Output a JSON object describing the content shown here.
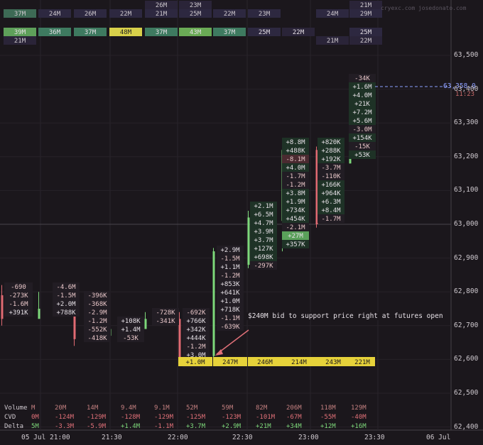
{
  "watermark": "cryexc.com josedonato.com",
  "price_axis": {
    "ticks": [
      "63,500",
      "63,400",
      "63,300",
      "63,200",
      "63,100",
      "63,000",
      "62,900",
      "62,800",
      "62,700",
      "62,600",
      "62,500",
      "62,400"
    ]
  },
  "time_axis": {
    "ticks": [
      "05 Jul 21:00",
      "21:30",
      "22:00",
      "22:30",
      "23:00",
      "23:30",
      "06 Jul"
    ]
  },
  "current_price": {
    "value": "63,358.0",
    "time_left": "11:23",
    "color": "#8ea0ff"
  },
  "annotation": "$240M bid to support price right at futures open",
  "colors": {
    "bg": "#1b171c",
    "green": "#7dd87a",
    "red": "#e06a72",
    "yellow_highlight": "#e6d23a"
  },
  "top_heatmap_row1": [
    "37M",
    "24M",
    "26M",
    "22M",
    "21M",
    "25M",
    "22M",
    "23M",
    "",
    "24M",
    "29M"
  ],
  "top_heatmap_row1_above": [
    "",
    "",
    "",
    "",
    "26M",
    "23M",
    "",
    "",
    "",
    "",
    "21M"
  ],
  "top_heatmap_row2": [
    "39M",
    "36M",
    "37M",
    "48M",
    "37M",
    "43M",
    "37M",
    "25M",
    "22M",
    "",
    "25M"
  ],
  "top_heatmap_row2_below": [
    "21M",
    "",
    "",
    "",
    "",
    "",
    "",
    "",
    "",
    "21M",
    "22M"
  ],
  "bottom_bid_row": [
    "+1.0M",
    "247M",
    "246M",
    "214M",
    "243M",
    "221M"
  ],
  "footprint_columns": [
    {
      "cells": [
        "-690",
        "-273K",
        "-1.6M",
        "+391K"
      ]
    },
    {
      "cells": [
        "-4.6M",
        "-1.5M",
        "+2.0M",
        "+788K"
      ]
    },
    {
      "cells": [
        "-396K",
        "-368K",
        "-2.9M",
        "-1.2M",
        "-552K",
        "-418K"
      ]
    },
    {
      "cells": [
        "+108K",
        "+1.4M",
        "-53K"
      ]
    },
    {
      "cells": [
        "-728K",
        "-341K"
      ]
    },
    {
      "cells": [
        "-692K",
        "+766K",
        "+342K",
        "+444K",
        "-1.2M",
        "+3.0M",
        "+1.0M"
      ]
    },
    {
      "cells": [
        "+2.9M",
        "-1.5M",
        "+1.1M",
        "-1.2M",
        "+853K",
        "+641K",
        "+1.0M",
        "+718K",
        "-1.1M",
        "-639K"
      ]
    },
    {
      "cells": [
        "+2.1M",
        "+6.5M",
        "+4.7M",
        "+3.9M",
        "+3.7M",
        "+127K",
        "+698K",
        "-297K"
      ]
    },
    {
      "cells": [
        "+8.8M",
        "+488K",
        "-8.1M",
        "+4.0M",
        "-1.7M",
        "-1.2M",
        "+3.8M",
        "+1.9M",
        "+734K",
        "+454K",
        "-2.1M",
        "+27M",
        "+357K"
      ]
    },
    {
      "cells": [
        "+820K",
        "+288K",
        "+192K",
        "-3.7M",
        "-110K",
        "+166K",
        "+964K",
        "+6.3M",
        "+8.4M",
        "-1.7M"
      ]
    },
    {
      "cells": [
        "-34K",
        "+1.6M",
        "+4.0M",
        "+21K",
        "+7.2M",
        "+5.6M",
        "-3.0M",
        "+154K",
        "-15K",
        "+53K"
      ]
    }
  ],
  "summary": {
    "volume_label": "Volume",
    "cvd_label": "CVD",
    "delta_label": "Delta",
    "volume": [
      "M",
      "20M",
      "14M",
      "9.4M",
      "9.1M",
      "52M",
      "59M",
      "82M",
      "206M",
      "118M",
      "129M"
    ],
    "cvd": [
      "0M",
      "-124M",
      "-129M",
      "-128M",
      "-129M",
      "-125M",
      "-123M",
      "-101M",
      "-67M",
      "-55M",
      "-40M"
    ],
    "delta": [
      "5M",
      "-3.3M",
      "-5.9M",
      "+1.4M",
      "-1.1M",
      "+3.7M",
      "+2.9M",
      "+21M",
      "+34M",
      "+12M",
      "+16M"
    ]
  },
  "chart_data": {
    "type": "footprint",
    "x": [
      "21:00",
      "21:15",
      "21:30",
      "21:45",
      "22:00",
      "22:15",
      "22:30",
      "22:45",
      "23:00",
      "23:15",
      "23:30"
    ],
    "series": [
      {
        "open": 62790,
        "close": 62720,
        "high": 62820,
        "low": 62700
      },
      {
        "open": 62720,
        "close": 62750,
        "high": 62800,
        "low": 62730
      },
      {
        "open": 62760,
        "close": 62660,
        "high": 62800,
        "low": 62640
      },
      {
        "open": 62670,
        "close": 62690,
        "high": 62720,
        "low": 62660
      },
      {
        "open": 62690,
        "close": 62720,
        "high": 62740,
        "low": 62690
      },
      {
        "open": 62720,
        "close": 62600,
        "high": 62740,
        "low": 62590
      },
      {
        "open": 62610,
        "close": 62920,
        "high": 62930,
        "low": 62600
      },
      {
        "open": 62880,
        "close": 63020,
        "high": 63040,
        "low": 62870
      },
      {
        "open": 63010,
        "close": 63220,
        "high": 63240,
        "low": 62920
      },
      {
        "open": 63220,
        "close": 63000,
        "high": 63230,
        "low": 62990
      },
      {
        "open": 63180,
        "close": 63358,
        "high": 63380,
        "low": 63180
      }
    ],
    "ylim": [
      62400,
      63550
    ],
    "grid": true
  }
}
